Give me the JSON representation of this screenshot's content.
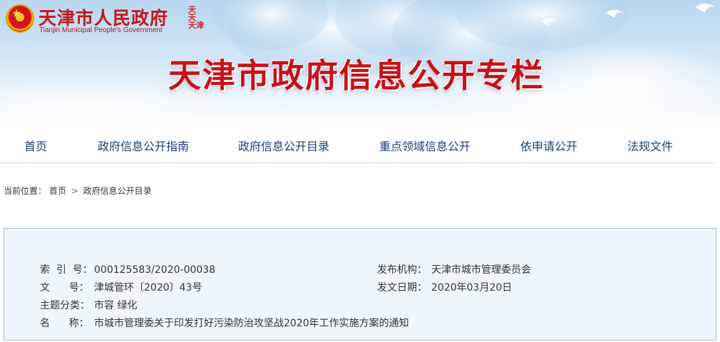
{
  "header": {
    "gov_name": "天津市人民政府",
    "gov_name_en": "Tianjin Municipal People's Government",
    "seal_text": [
      "天",
      "天",
      "天津"
    ],
    "banner_title": "天津市政府信息公开专栏",
    "colors": {
      "brand_red": "#c5121a",
      "nav_blue": "#1a3f7a",
      "box_bg": "#eef5fb",
      "box_border": "#9fc3e2"
    }
  },
  "nav": {
    "items": [
      {
        "label": "首页"
      },
      {
        "label": "政府信息公开指南"
      },
      {
        "label": "政府信息公开目录"
      },
      {
        "label": "重点领域信息公开"
      },
      {
        "label": "依申请公开"
      },
      {
        "label": "法规文件"
      }
    ]
  },
  "breadcrumb": {
    "prefix": "当前位置：",
    "items": [
      {
        "label": "首页"
      },
      {
        "label": "政府信息公开目录"
      }
    ],
    "separator": ">"
  },
  "document_info": {
    "index_label": "索  引  号：",
    "index_value": "000125583/2020-00038",
    "publisher_label": "发布机构：",
    "publisher_value": "天津市城市管理委员会",
    "doc_no_label": "文      号：",
    "doc_no_value": "津城管环〔2020〕43号",
    "date_label": "发文日期：",
    "date_value": "2020年03月20日",
    "topic_label": "主题分类：",
    "topic_value": "市容 绿化",
    "title_label": "名      称：",
    "title_value": "市城市管理委关于印发打好污染防治攻坚战2020年工作实施方案的通知"
  }
}
